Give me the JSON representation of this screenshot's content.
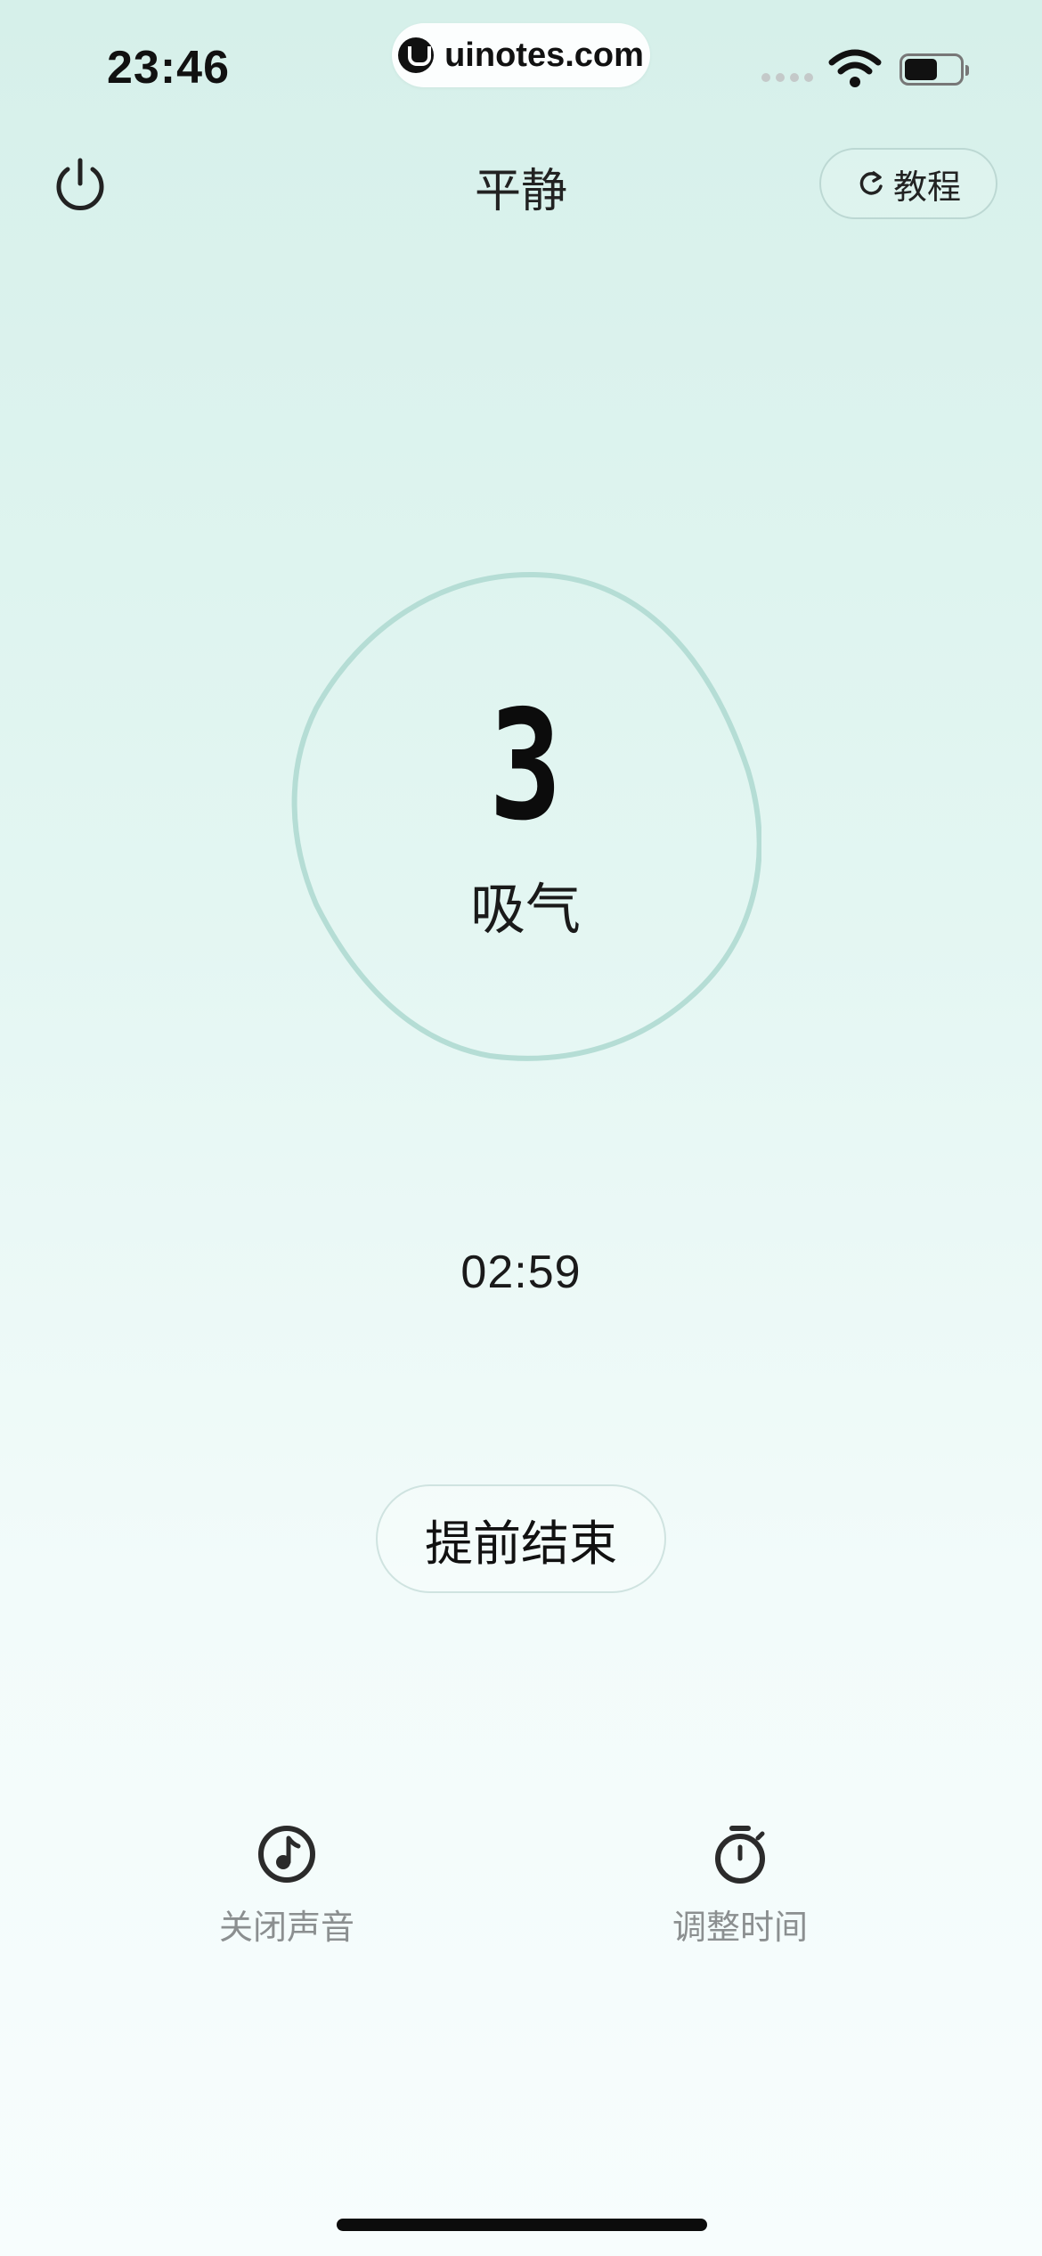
{
  "status_bar": {
    "time": "23:46",
    "url": "uinotes.com"
  },
  "header": {
    "title": "平静",
    "tutorial_label": "教程"
  },
  "breath": {
    "count": "3",
    "phase": "吸气"
  },
  "timer": "02:59",
  "end_button_label": "提前结束",
  "actions": {
    "sound_label": "关闭声音",
    "time_label": "调整时间"
  },
  "icons": {
    "power": "power-icon",
    "refresh": "refresh-icon",
    "music": "music-note-icon",
    "stopwatch": "stopwatch-icon"
  },
  "colors": {
    "accent_ring": "#b5ddd5",
    "background_top": "#d6f0ea",
    "background_bottom": "#f7fdfd"
  }
}
